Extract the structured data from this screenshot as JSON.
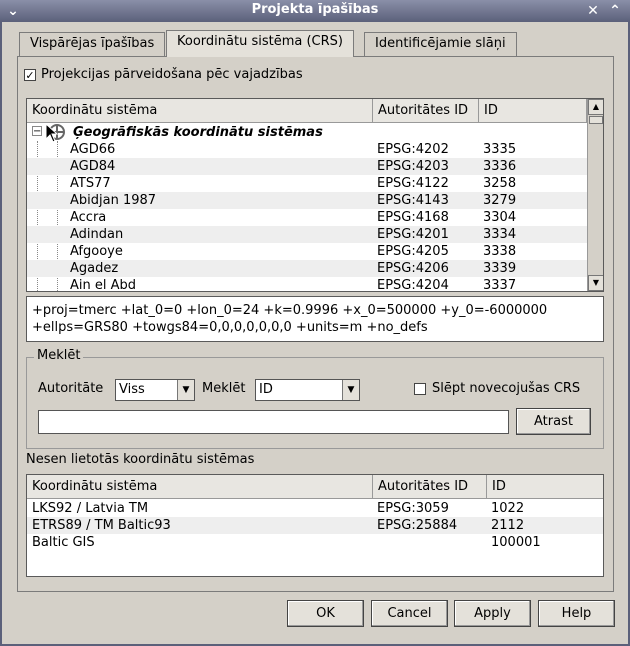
{
  "window": {
    "title": "Projekta īpašības"
  },
  "tabs": [
    "Vispārējas īpašības",
    "Koordinātu sistēma (CRS)",
    "Identificējamie slāņi"
  ],
  "reproject": {
    "checked": true,
    "label": "Projekcijas pārveidošana pēc vajadzības"
  },
  "crs_table": {
    "headers": [
      "Koordinātu sistēma",
      "Autoritātes ID",
      "ID"
    ],
    "group_label": "Ģeogrāfiskās koordinātu sistēmas",
    "rows": [
      {
        "name": "AGD66",
        "auth": "EPSG:4202",
        "id": "3335"
      },
      {
        "name": "AGD84",
        "auth": "EPSG:4203",
        "id": "3336"
      },
      {
        "name": "ATS77",
        "auth": "EPSG:4122",
        "id": "3258"
      },
      {
        "name": "Abidjan 1987",
        "auth": "EPSG:4143",
        "id": "3279"
      },
      {
        "name": "Accra",
        "auth": "EPSG:4168",
        "id": "3304"
      },
      {
        "name": "Adindan",
        "auth": "EPSG:4201",
        "id": "3334"
      },
      {
        "name": "Afgooye",
        "auth": "EPSG:4205",
        "id": "3338"
      },
      {
        "name": "Agadez",
        "auth": "EPSG:4206",
        "id": "3339"
      },
      {
        "name": "Ain el Abd",
        "auth": "EPSG:4204",
        "id": "3337"
      }
    ]
  },
  "proj_string": {
    "line1": "+proj=tmerc +lat_0=0 +lon_0=24 +k=0.9996 +x_0=500000 +y_0=-6000000",
    "line2": "+ellps=GRS80 +towgs84=0,0,0,0,0,0,0 +units=m +no_defs"
  },
  "search": {
    "group_title": "Meklēt",
    "authority_label": "Autoritāte",
    "authority_value": "Viss",
    "search_label": "Meklēt",
    "search_value": "ID",
    "hide_deprecated": {
      "checked": false,
      "label": "Slēpt novecojušas CRS"
    },
    "find_button": "Atrast",
    "input_value": ""
  },
  "recent": {
    "title": "Nesen lietotās koordinātu sistēmas",
    "headers": [
      "Koordinātu sistēma",
      "Autoritātes ID",
      "ID"
    ],
    "rows": [
      {
        "name": "LKS92 / Latvia TM",
        "auth": "EPSG:3059",
        "id": "1022"
      },
      {
        "name": "ETRS89 / TM Baltic93",
        "auth": "EPSG:25884",
        "id": "2112"
      },
      {
        "name": "Baltic GIS",
        "auth": "",
        "id": "100001"
      }
    ]
  },
  "buttons": {
    "ok": "OK",
    "cancel": "Cancel",
    "apply": "Apply",
    "help": "Help"
  }
}
